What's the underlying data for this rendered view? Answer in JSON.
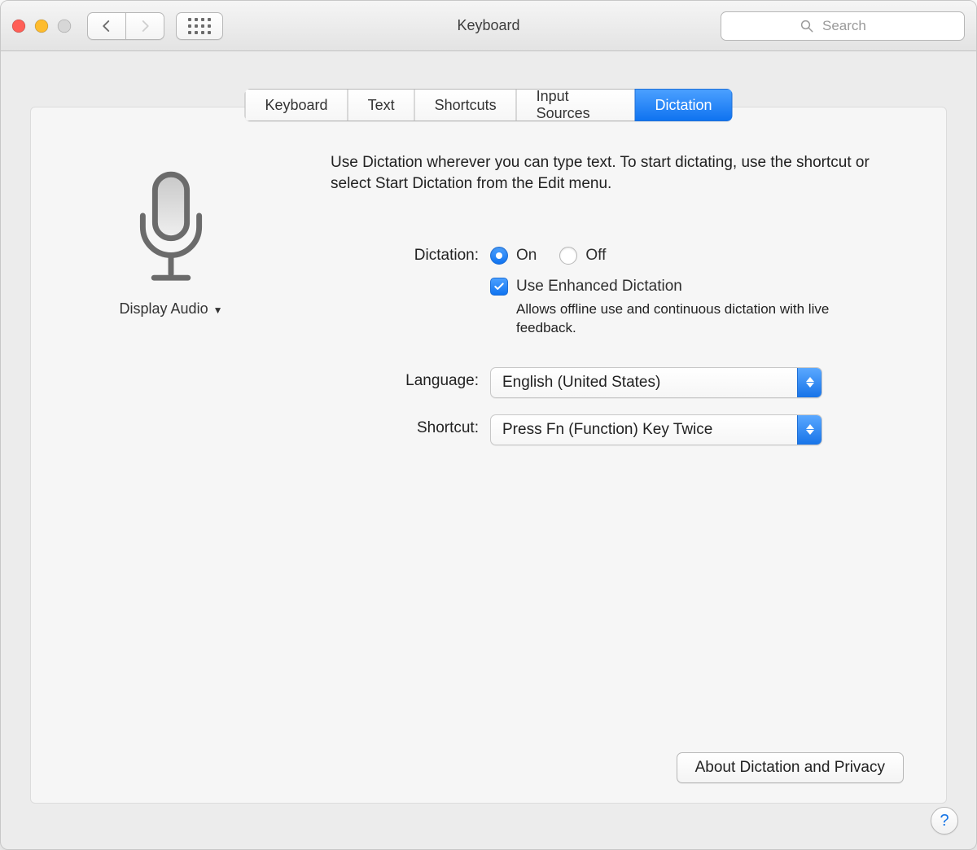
{
  "window": {
    "title": "Keyboard"
  },
  "toolbar": {
    "search_placeholder": "Search"
  },
  "tabs": [
    {
      "label": "Keyboard"
    },
    {
      "label": "Text"
    },
    {
      "label": "Shortcuts"
    },
    {
      "label": "Input Sources"
    },
    {
      "label": "Dictation"
    }
  ],
  "active_tab_index": 4,
  "mic": {
    "input_source": "Display Audio"
  },
  "intro": "Use Dictation wherever you can type text. To start dictating, use the shortcut or select Start Dictation from the Edit menu.",
  "dictation": {
    "label": "Dictation:",
    "on_label": "On",
    "off_label": "Off",
    "value": "On",
    "enhanced_label": "Use Enhanced Dictation",
    "enhanced_checked": true,
    "enhanced_desc": "Allows offline use and continuous dictation with live feedback."
  },
  "language": {
    "label": "Language:",
    "value": "English (United States)"
  },
  "shortcut": {
    "label": "Shortcut:",
    "value": "Press Fn (Function) Key Twice"
  },
  "about_button": "About Dictation and Privacy",
  "help_button": "?",
  "colors": {
    "accent": "#1a82ff"
  }
}
